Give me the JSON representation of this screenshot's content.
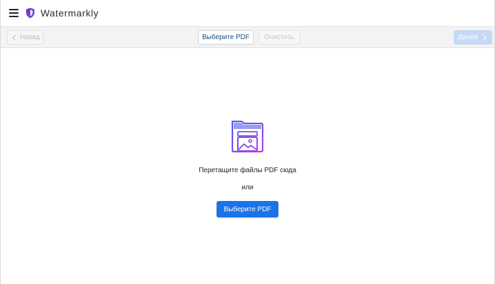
{
  "app": {
    "title": "Watermarkly",
    "menu_icon": "hamburger-menu-icon",
    "logo_icon": "shield-logo-icon"
  },
  "toolbar": {
    "back_label": "Назад",
    "select_label": "Выберите PDF",
    "clear_label": "Очистить",
    "next_label": "Далее"
  },
  "dropzone": {
    "illustration_icon": "folder-image-icon",
    "prompt": "Перетащите файлы PDF сюда",
    "or": "или",
    "button_label": "Выберите PDF"
  },
  "colors": {
    "primary": "#1a73e8",
    "primary_disabled": "#c5d8f6",
    "brand_purple": "#7b3fe4",
    "toolbar_bg": "#f3f3f3"
  }
}
